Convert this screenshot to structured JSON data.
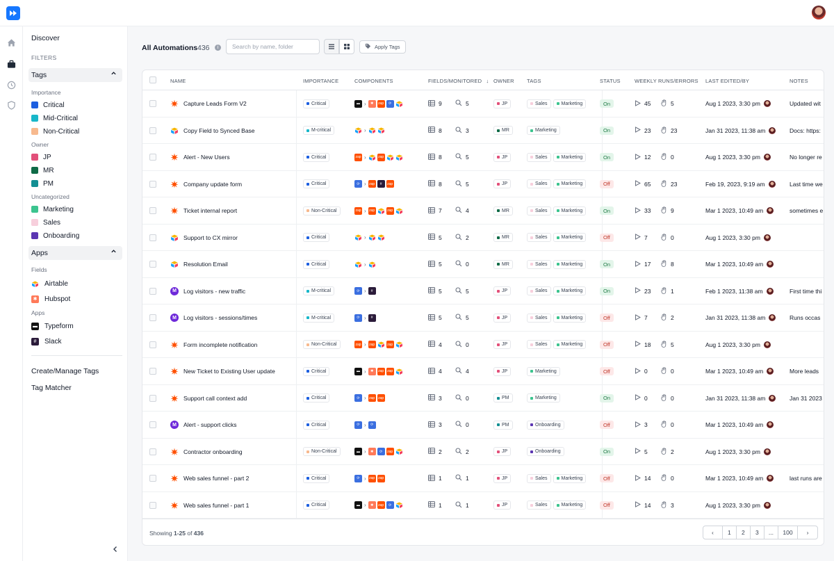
{
  "sidebar": {
    "discover": "Discover",
    "filters": "FILTERS",
    "tags_header": "Tags",
    "importance_label": "Importance",
    "importance": [
      {
        "label": "Critical",
        "color": "#1d5fe0"
      },
      {
        "label": "Mid-Critical",
        "color": "#18b7c9"
      },
      {
        "label": "Non-Critical",
        "color": "#f7b98e"
      }
    ],
    "owner_label": "Owner",
    "owners": [
      {
        "label": "JP",
        "color": "#e2507a"
      },
      {
        "label": "MR",
        "color": "#0f6b47"
      },
      {
        "label": "PM",
        "color": "#138f93"
      }
    ],
    "uncat_label": "Uncategorized",
    "uncat": [
      {
        "label": "Marketing",
        "color": "#3cc48f"
      },
      {
        "label": "Sales",
        "color": "#f7cfdc"
      },
      {
        "label": "Onboarding",
        "color": "#5b36b2"
      }
    ],
    "apps_header": "Apps",
    "fields_label": "Fields",
    "fields": [
      {
        "label": "Airtable"
      },
      {
        "label": "Hubspot"
      }
    ],
    "apps_label": "Apps",
    "apps": [
      {
        "label": "Typeform"
      },
      {
        "label": "Slack"
      }
    ],
    "create_manage": "Create/Manage Tags",
    "tag_matcher": "Tag Matcher"
  },
  "header": {
    "title": "All Automations",
    "count": "436",
    "search_placeholder": "Search by name, folder",
    "apply_tags": "Apply Tags"
  },
  "columns": {
    "name": "NAME",
    "importance": "IMPORTANCE",
    "components": "COMPONENTS",
    "fields": "FIELDS/MONITORED",
    "owner": "OWNER",
    "tags": "TAGS",
    "status": "STATUS",
    "runs": "WEEKLY RUNS/ERRORS",
    "edited": "LAST EDITED/BY",
    "notes": "NOTES"
  },
  "rows": [
    {
      "name": "Capture Leads Form V2",
      "icon": "zapier",
      "imp": "Critical",
      "comps": [
        "typeform",
        ">",
        "hubspot",
        "zapier",
        "workato",
        "airtable"
      ],
      "fields": "9",
      "mon": "5",
      "owner": "JP",
      "tags": [
        "Sales",
        "Marketing"
      ],
      "status": "On",
      "runs": "45",
      "errors": "5",
      "edited": "Aug 1 2023, 3:30 pm",
      "notes": "Updated wit"
    },
    {
      "name": "Copy Field to Synced Base",
      "icon": "airtable",
      "imp": "M-critical",
      "comps": [
        "airtable",
        ">",
        "airtable",
        "airtable"
      ],
      "fields": "8",
      "mon": "3",
      "owner": "MR",
      "tags": [
        "Marketing"
      ],
      "status": "On",
      "runs": "23",
      "errors": "23",
      "edited": "Jan 31 2023, 11:38 am",
      "notes": "Docs: https:"
    },
    {
      "name": "Alert - New Users",
      "icon": "zapier",
      "imp": "Critical",
      "comps": [
        "zapier",
        ">",
        "airtable",
        "zapier",
        "airtable",
        "airtable"
      ],
      "fields": "8",
      "mon": "5",
      "owner": "JP",
      "tags": [
        "Sales",
        "Marketing"
      ],
      "status": "On",
      "runs": "12",
      "errors": "0",
      "edited": "Aug 1 2023, 3:30 pm",
      "notes": "No longer re"
    },
    {
      "name": "Company update form",
      "icon": "zapier",
      "imp": "Critical",
      "comps": [
        "workato",
        ">",
        "zapier",
        "slack",
        "zapier"
      ],
      "fields": "8",
      "mon": "5",
      "owner": "JP",
      "tags": [
        "Sales",
        "Marketing"
      ],
      "status": "Off",
      "runs": "65",
      "errors": "23",
      "edited": "Feb 19, 2023, 9:19 am",
      "notes": "Last time we"
    },
    {
      "name": "Ticket internal report",
      "icon": "zapier",
      "imp": "Non-Critical",
      "comps": [
        "zapier",
        ">",
        "zapier",
        "airtable",
        "zapier",
        "airtable"
      ],
      "fields": "7",
      "mon": "4",
      "owner": "MR",
      "tags": [
        "Sales",
        "Marketing"
      ],
      "status": "On",
      "runs": "33",
      "errors": "9",
      "edited": "Mar 1 2023, 10:49 am",
      "notes": "sometimes e"
    },
    {
      "name": "Support to CX mirror",
      "icon": "airtable",
      "imp": "Critical",
      "comps": [
        "airtable",
        ">",
        "airtable",
        "airtable"
      ],
      "fields": "5",
      "mon": "2",
      "owner": "MR",
      "tags": [
        "Sales",
        "Marketing"
      ],
      "status": "Off",
      "runs": "7",
      "errors": "0",
      "edited": "Aug 1 2023, 3:30 pm",
      "notes": ""
    },
    {
      "name": "Resolution Email",
      "icon": "airtable",
      "imp": "Critical",
      "comps": [
        "airtable",
        ">",
        "airtable"
      ],
      "fields": "5",
      "mon": "0",
      "owner": "MR",
      "tags": [
        "Sales",
        "Marketing"
      ],
      "status": "On",
      "runs": "17",
      "errors": "8",
      "edited": "Mar 1 2023, 10:49 am",
      "notes": ""
    },
    {
      "name": "Log visitors - new traffic",
      "icon": "make",
      "imp": "M-critical",
      "comps": [
        "workato",
        ">",
        "slack"
      ],
      "fields": "5",
      "mon": "5",
      "owner": "JP",
      "tags": [
        "Sales",
        "Marketing"
      ],
      "status": "On",
      "runs": "23",
      "errors": "1",
      "edited": "Feb 1 2023, 11:38 am",
      "notes": "First time thi"
    },
    {
      "name": "Log visitors - sessions/times",
      "icon": "make",
      "imp": "M-critical",
      "comps": [
        "workato",
        ">",
        "slack"
      ],
      "fields": "5",
      "mon": "5",
      "owner": "JP",
      "tags": [
        "Sales",
        "Marketing"
      ],
      "status": "Off",
      "runs": "7",
      "errors": "2",
      "edited": "Jan 31 2023, 11:38 am",
      "notes": "Runs occas"
    },
    {
      "name": "Form incomplete notification",
      "icon": "zapier",
      "imp": "Non-Critical",
      "comps": [
        "zapier",
        ">",
        "zapier",
        "airtable",
        "zapier",
        "airtable"
      ],
      "fields": "4",
      "mon": "0",
      "owner": "JP",
      "tags": [
        "Sales",
        "Marketing"
      ],
      "status": "Off",
      "runs": "18",
      "errors": "5",
      "edited": "Aug 1 2023, 3:30 pm",
      "notes": ""
    },
    {
      "name": "New Ticket to Existing User update",
      "icon": "zapier",
      "imp": "Critical",
      "comps": [
        "typeform",
        ">",
        "hubspot",
        "zapier",
        "zapier",
        "airtable"
      ],
      "fields": "4",
      "mon": "4",
      "owner": "JP",
      "tags": [
        "Marketing"
      ],
      "status": "Off",
      "runs": "0",
      "errors": "0",
      "edited": "Mar 1 2023, 10:49 am",
      "notes": "More leads"
    },
    {
      "name": "Support call context add",
      "icon": "zapier",
      "imp": "Critical",
      "comps": [
        "workato",
        ">",
        "zapier",
        "zapier"
      ],
      "fields": "3",
      "mon": "0",
      "owner": "PM",
      "tags": [
        "Marketing"
      ],
      "status": "On",
      "runs": "0",
      "errors": "0",
      "edited": "Jan 31 2023, 11:38 am",
      "notes": "Jan 31 2023"
    },
    {
      "name": "Alert - support clicks",
      "icon": "make",
      "imp": "Critical",
      "comps": [
        "workato",
        ">",
        "workato"
      ],
      "fields": "3",
      "mon": "0",
      "owner": "PM",
      "tags": [
        "Onboarding"
      ],
      "status": "Off",
      "runs": "3",
      "errors": "0",
      "edited": "Mar 1 2023, 10:49 am",
      "notes": ""
    },
    {
      "name": "Contractor onboarding",
      "icon": "zapier",
      "imp": "Non-Critical",
      "comps": [
        "typeform",
        ">",
        "hubspot",
        "workato",
        "zapier",
        "airtable"
      ],
      "fields": "2",
      "mon": "2",
      "owner": "JP",
      "tags": [
        "Onboarding"
      ],
      "status": "On",
      "runs": "5",
      "errors": "2",
      "edited": "Aug 1 2023, 3:30 pm",
      "notes": ""
    },
    {
      "name": "Web sales funnel - part 2",
      "icon": "zapier",
      "imp": "Critical",
      "comps": [
        "workato",
        ">",
        "zapier",
        "zapier"
      ],
      "fields": "1",
      "mon": "1",
      "owner": "JP",
      "tags": [
        "Sales",
        "Marketing"
      ],
      "status": "Off",
      "runs": "14",
      "errors": "0",
      "edited": "Mar 1 2023, 10:49 am",
      "notes": "last runs are"
    },
    {
      "name": "Web sales funnel - part 1",
      "icon": "zapier",
      "imp": "Critical",
      "comps": [
        "typeform",
        ">",
        "hubspot",
        "zapier",
        "workato",
        "airtable"
      ],
      "fields": "1",
      "mon": "1",
      "owner": "JP",
      "tags": [
        "Sales",
        "Marketing"
      ],
      "status": "Off",
      "runs": "14",
      "errors": "3",
      "edited": "Aug 1 2023, 3:30 pm",
      "notes": ""
    }
  ],
  "footer": {
    "showing_prefix": "Showing ",
    "range": "1-25",
    "of": " of ",
    "total": "436",
    "pages": [
      "‹",
      "1",
      "2",
      "3",
      "...",
      "100",
      "›"
    ]
  },
  "colors": {
    "importance": {
      "Critical": "#1d5fe0",
      "M-critical": "#18b7c9",
      "Non-Critical": "#f7b98e"
    },
    "owner": {
      "JP": "#e2507a",
      "MR": "#0f6b47",
      "PM": "#138f93"
    },
    "tag": {
      "Sales": "#f7cfdc",
      "Marketing": "#3cc48f",
      "Onboarding": "#5b36b2"
    }
  }
}
